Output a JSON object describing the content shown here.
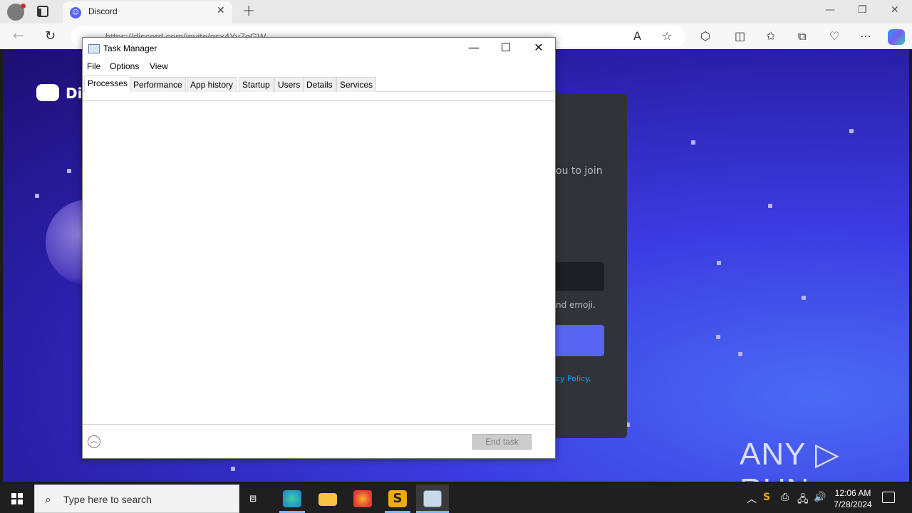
{
  "browser": {
    "tab_title": "Discord",
    "tab_close": "✕",
    "new_tab": "+",
    "url": "https://discord.com/invite/gsx4Yv7qGW",
    "window_controls": [
      "—",
      "❐",
      "✕"
    ]
  },
  "page": {
    "brand": "Di",
    "card_text1": "ou to join",
    "card_text2": "nd emoji.",
    "card_link": "cy Policy",
    "card_link_suffix": ".",
    "watermark": "ANY ▷ RUN"
  },
  "task_manager": {
    "title": "Task Manager",
    "menu": [
      "File",
      "Options",
      "View"
    ],
    "tabs": [
      "Processes",
      "Performance",
      "App history",
      "Startup",
      "Users",
      "Details",
      "Services"
    ],
    "active_tab": "Processes",
    "end_task": "End task"
  },
  "taskbar": {
    "search_placeholder": "Type here to search",
    "time": "12:06 AM",
    "date": "7/28/2024"
  }
}
